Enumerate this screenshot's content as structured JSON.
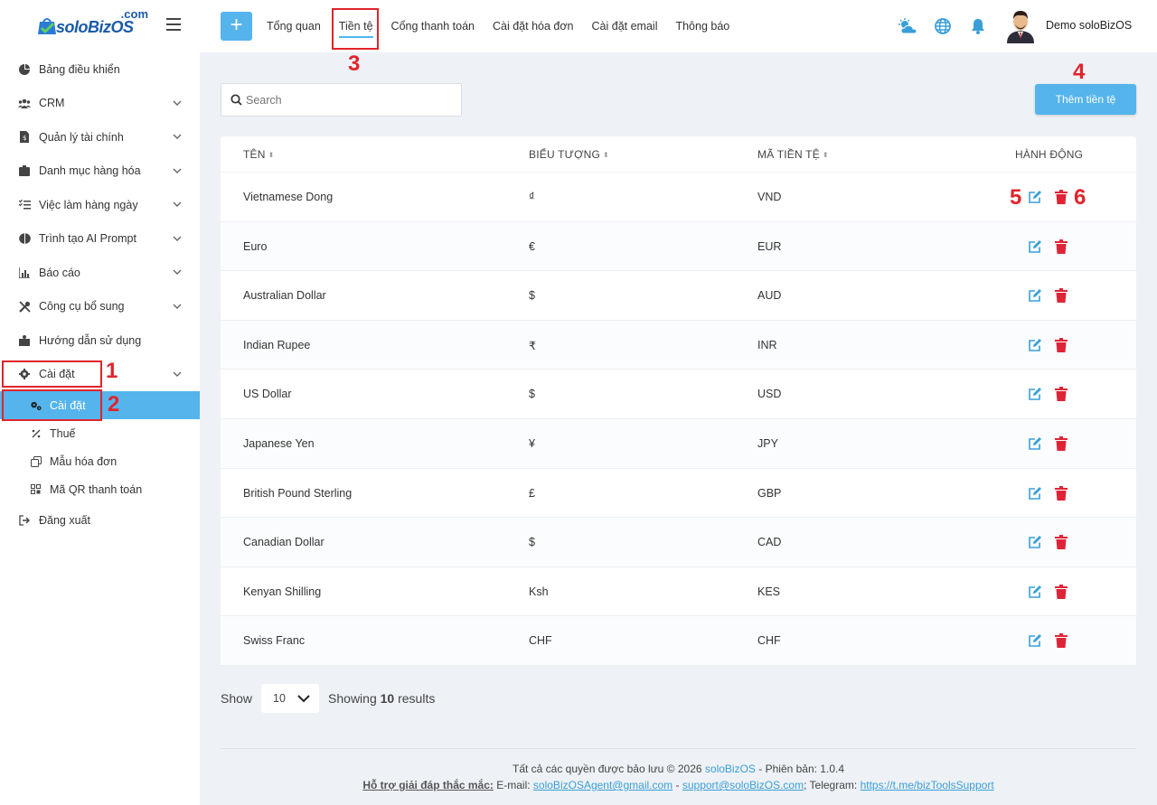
{
  "brand": {
    "com": ".com",
    "name": "soloBizOS"
  },
  "sidebar": {
    "items": [
      {
        "label": "Bảng điều khiển",
        "icon": "pie-chart-icon",
        "expandable": false
      },
      {
        "label": "CRM",
        "icon": "users-icon",
        "expandable": true
      },
      {
        "label": "Quản lý tài chính",
        "icon": "finance-doc-icon",
        "expandable": true
      },
      {
        "label": "Danh mục hàng hóa",
        "icon": "box-icon",
        "expandable": true
      },
      {
        "label": "Việc làm hàng ngày",
        "icon": "tasks-icon",
        "expandable": true
      },
      {
        "label": "Trình tạo AI Prompt",
        "icon": "brain-icon",
        "expandable": true
      },
      {
        "label": "Báo cáo",
        "icon": "bar-chart-icon",
        "expandable": true
      },
      {
        "label": "Công cụ bổ sung",
        "icon": "tools-icon",
        "expandable": true
      },
      {
        "label": "Hướng dẫn sử dụng",
        "icon": "book-icon",
        "expandable": false
      },
      {
        "label": "Cài đặt",
        "icon": "gear-icon",
        "expandable": true
      }
    ],
    "subitems": [
      {
        "label": "Cài đặt",
        "icon": "gears-icon",
        "active": true
      },
      {
        "label": "Thuế",
        "icon": "percent-icon",
        "active": false
      },
      {
        "label": "Mẫu hóa đơn",
        "icon": "copy-icon",
        "active": false
      },
      {
        "label": "Mã QR thanh toán",
        "icon": "qr-icon",
        "active": false
      }
    ],
    "logout": {
      "label": "Đăng xuất",
      "icon": "logout-icon"
    }
  },
  "topbar": {
    "plus": "+",
    "tabs": [
      "Tổng quan",
      "Tiền tệ",
      "Cổng thanh toán",
      "Cài đặt hóa đơn",
      "Cài đặt email",
      "Thông báo"
    ],
    "active_tab": "Tiền tệ",
    "user_name": "Demo soloBizOS"
  },
  "search": {
    "placeholder": "Search",
    "value": ""
  },
  "add_button": "Thêm tiền tệ",
  "table": {
    "headers": [
      "TÊN",
      "BIỂU TƯỢNG",
      "MÃ TIỀN TỆ",
      "HÀNH ĐỘNG"
    ],
    "rows": [
      {
        "name": "Vietnamese Dong",
        "symbol": "₫",
        "code": "VND"
      },
      {
        "name": "Euro",
        "symbol": "€",
        "code": "EUR"
      },
      {
        "name": "Australian Dollar",
        "symbol": "$",
        "code": "AUD"
      },
      {
        "name": "Indian Rupee",
        "symbol": "₹",
        "code": "INR"
      },
      {
        "name": "US Dollar",
        "symbol": "$",
        "code": "USD"
      },
      {
        "name": "Japanese Yen",
        "symbol": "¥",
        "code": "JPY"
      },
      {
        "name": "British Pound Sterling",
        "symbol": "£",
        "code": "GBP"
      },
      {
        "name": "Canadian Dollar",
        "symbol": "$",
        "code": "CAD"
      },
      {
        "name": "Kenyan Shilling",
        "symbol": "Ksh",
        "code": "KES"
      },
      {
        "name": "Swiss Franc",
        "symbol": "CHF",
        "code": "CHF"
      }
    ]
  },
  "pager": {
    "show_label": "Show",
    "page_size": "10",
    "showing_prefix": "Showing",
    "count": "10",
    "results_suffix": "results"
  },
  "footer": {
    "line1_prefix": "Tất cả các quyền được bảo lưu © 2026",
    "line1_brand": "soloBizOS",
    "line1_suffix": "- Phiên bản: 1.0.4",
    "support_label": "Hỗ trợ giải đáp thắc mắc:",
    "email_label": "E-mail:",
    "email1": "soloBizOSAgent@gmail.com",
    "sep": "-",
    "email2": "support@soloBizOS.com",
    "telegram_label": "; Telegram:",
    "telegram": "https://t.me/bizToolsSupport"
  },
  "annotations": [
    "1",
    "2",
    "3",
    "4",
    "5",
    "6"
  ],
  "colors": {
    "accent": "#55b4ec",
    "danger": "#e02437",
    "annotation": "#e0242b"
  }
}
